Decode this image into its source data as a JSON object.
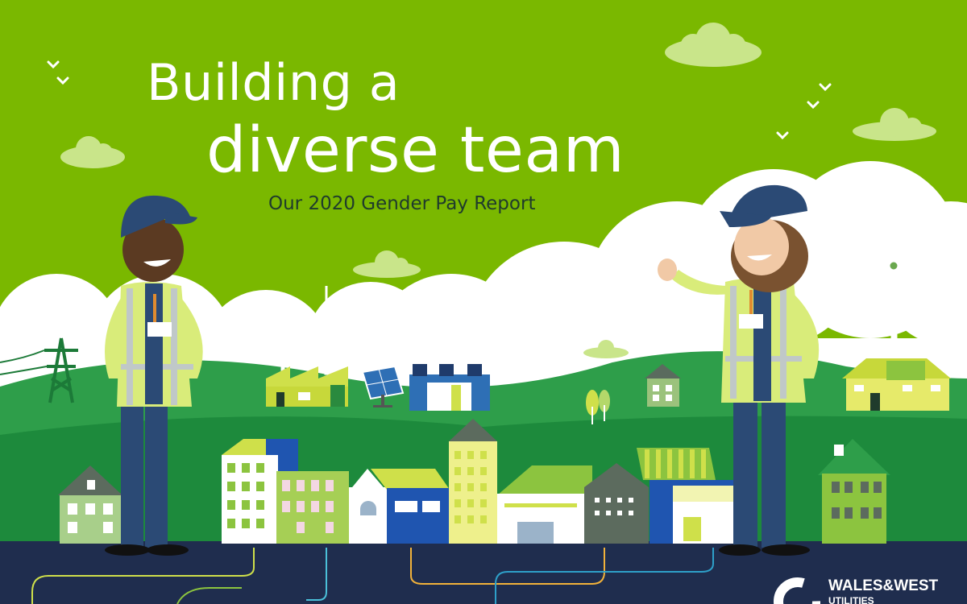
{
  "title": {
    "line1": "Building a",
    "line2": "diverse team",
    "subtitle": "Our 2020 Gender Pay Report"
  },
  "logo": {
    "name": "WALES&WEST",
    "suffix": "UTILITIES"
  },
  "colors": {
    "sky": "#7ab800",
    "hill": "#2e9e4a",
    "hill_dark": "#1d8a3c",
    "road": "#1f2d4e",
    "cloud": "#ffffff",
    "jacket": "#d9ec7a",
    "uniform": "#2b4a75"
  },
  "icons": [
    "cloud-icon",
    "bird-icon",
    "wind-turbine-icon",
    "pylon-icon",
    "solar-panel-icon",
    "factory-icon",
    "house-icon",
    "worker-icon"
  ]
}
